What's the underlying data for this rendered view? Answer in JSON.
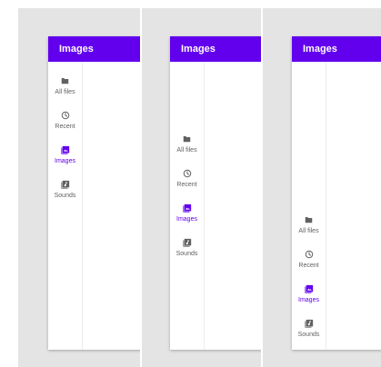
{
  "colors": {
    "primary": "#6200ee",
    "on_primary": "#ffffff",
    "icon_inactive": "#616161",
    "label_inactive": "#606060",
    "panel_bg": "#e4e4e4"
  },
  "app_bar": {
    "title": "Images"
  },
  "rail": {
    "selected": "images",
    "items": [
      {
        "id": "all_files",
        "label": "All files",
        "icon": "folder-icon"
      },
      {
        "id": "recent",
        "label": "Recent",
        "icon": "clock-icon"
      },
      {
        "id": "images",
        "label": "Images",
        "icon": "image-icon"
      },
      {
        "id": "sounds",
        "label": "Sounds",
        "icon": "music-library-icon"
      }
    ]
  },
  "variants": [
    {
      "rail_alignment": "top"
    },
    {
      "rail_alignment": "center"
    },
    {
      "rail_alignment": "bottom"
    }
  ]
}
